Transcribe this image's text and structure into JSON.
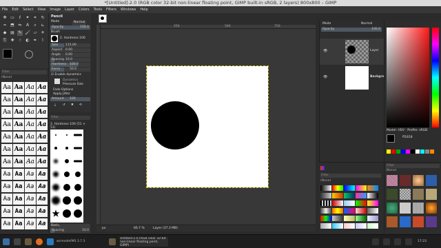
{
  "window": {
    "title": "*[Untitled]-2.0 (RGB color 32-bit non-linear floating point, GIMP built-in sRGB, 2 layers) 800x800 – GIMP"
  },
  "menu": [
    "File",
    "Edit",
    "Select",
    "View",
    "Image",
    "Layer",
    "Colors",
    "Tools",
    "Filters",
    "Windows",
    "Help"
  ],
  "tool_options": {
    "title": "Pencil",
    "mode_label": "Mode",
    "mode_value": "Normal",
    "opacity_label": "Opacity",
    "opacity_value": "100.0",
    "brush_label": "Brush",
    "brush_value": "2. Hardness 100",
    "size_label": "Size",
    "size_value": "115.00",
    "aspect_label": "Aspect",
    "aspect_value": "0.00",
    "angle_label": "Angle",
    "angle_value": "0.00",
    "spacing_label": "Spacing",
    "spacing_value": "10.0",
    "hardness_label": "Hardness",
    "hardness_value": "100.0",
    "force_label": "Force",
    "force_value": "50.0",
    "enable_dynamics": "Enable dynamics",
    "dynamics_label": "Dynamics",
    "dynamics_value": "Pressure Size",
    "fade_options": "Fade Options",
    "apply_jitter": "Apply Jitter",
    "amount_label": "Amount",
    "amount_value": "100"
  },
  "fonts": {
    "filter_placeholder": "Filter",
    "tag": "(None)",
    "sample": "Aa"
  },
  "brushes": {
    "filter_placeholder": "Filter",
    "selected": "2. Hardness 100 (51 × 51)",
    "tag": "Basic,",
    "spacing_label": "Spacing",
    "spacing_value": "10.0"
  },
  "image_tab": {
    "ruler_ticks": [
      "250",
      "500",
      "750"
    ]
  },
  "status": {
    "unit": "px",
    "zoom": "66.7 %",
    "layer_info": "Layer (37.3 MB)"
  },
  "layers": {
    "mode_label": "Mode",
    "mode_value": "Normal",
    "opacity_label": "Opacity",
    "opacity_value": "100.0",
    "items": [
      {
        "name": "Layer",
        "visible": true
      },
      {
        "name": "Background",
        "visible": true
      }
    ]
  },
  "colors": {
    "model_label": "Model: HSV - Profile: sRGB",
    "hex_value": "ff1818"
  },
  "gradients": {
    "filter_placeholder": "Filter",
    "tag": "(None)"
  },
  "patterns": {
    "filter_placeholder": "Filter",
    "tag": "(None)"
  },
  "taskbar": {
    "app1_label": "Untitled-2.0 (RGB color 32-bit non-linear floating point, GIMP)",
    "app2_label": "wcmodel/MS 3.7.3",
    "time": "17:23"
  },
  "accent": "#ff1818"
}
